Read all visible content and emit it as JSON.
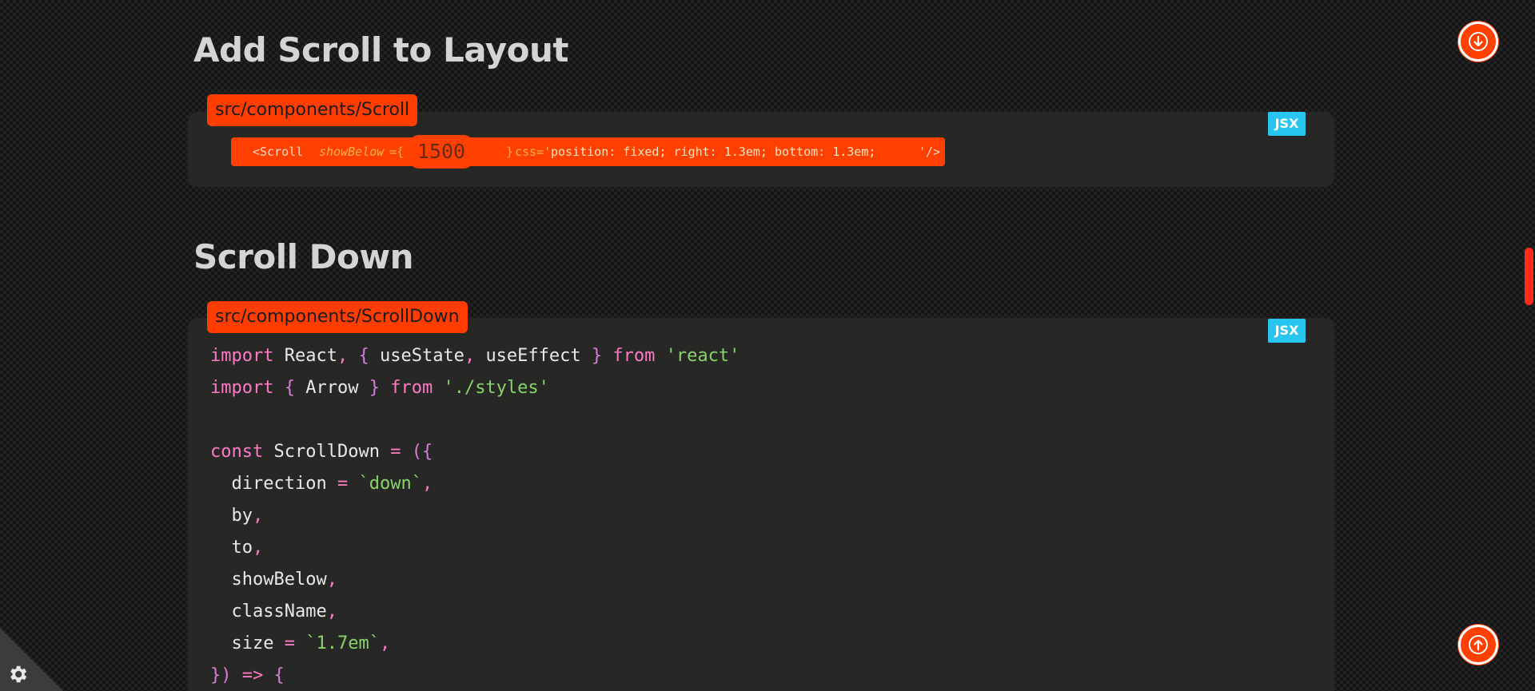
{
  "section_one": {
    "heading": "Add Scroll to Layout",
    "file_tab": "src/components/Scroll",
    "lang_badge": "JSX",
    "highlight": {
      "tag_open": "<Scroll",
      "attr_name": "showBelow",
      "attr_eq": "={",
      "number": "1500",
      "brace_close": "}",
      "css_attr": "css='",
      "css_value": "position: fixed; right: 1.3em; bottom: 1.3em;",
      "tag_close": "'/>"
    }
  },
  "section_two": {
    "heading": "Scroll Down",
    "file_tab": "src/components/ScrollDown",
    "lang_badge": "JSX",
    "code_lines": [
      "import React, { useState, useEffect } from 'react'",
      "import { Arrow } from './styles'",
      "",
      "const ScrollDown = ({",
      "  direction = `down`,",
      "  by,",
      "  to,",
      "  showBelow,",
      "  className,",
      "  size = `1.7em`,",
      "}) => {"
    ]
  },
  "buttons": {
    "scroll_down_icon": "arrow-down-circle-icon",
    "scroll_up_icon": "arrow-up-circle-icon",
    "settings_icon": "gear-icon"
  },
  "colors": {
    "accent": "#ff4000",
    "badge": "#27c5f0",
    "keyword": "#ff79c6",
    "string": "#8ad36b",
    "card": "#272826",
    "heading": "#d4d4d4"
  }
}
